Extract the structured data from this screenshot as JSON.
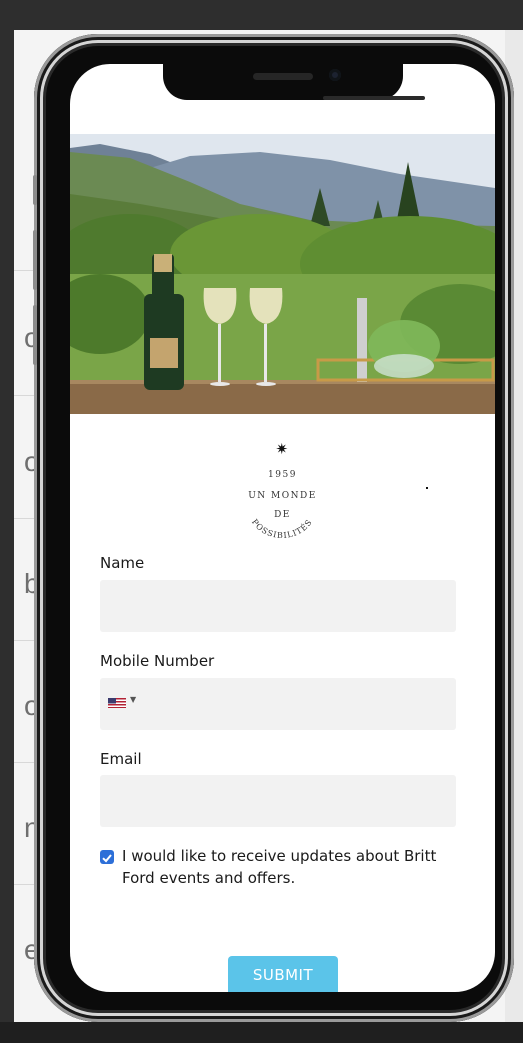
{
  "background": {
    "fragments": [
      "on",
      "or",
      "b",
      "ol",
      "nt",
      "e"
    ]
  },
  "logo": {
    "year": "1959",
    "line1": "UN MONDE",
    "line2": "DE",
    "arc": "POSSIBILITÉS"
  },
  "form": {
    "name_label": "Name",
    "mobile_label": "Mobile Number",
    "email_label": "Email",
    "name_value": "",
    "mobile_value": "",
    "email_value": "",
    "consent_checked": true,
    "consent_text": "I would like to receive updates about Britt Ford events and offers.",
    "submit_label": "SUBMIT"
  },
  "colors": {
    "submit": "#5bc4e9",
    "checkbox": "#2d6fd8",
    "field_bg": "#f2f2f2"
  },
  "icons": [
    "us-flag-icon",
    "caret-down-icon",
    "star-icon",
    "checkbox-icon"
  ]
}
